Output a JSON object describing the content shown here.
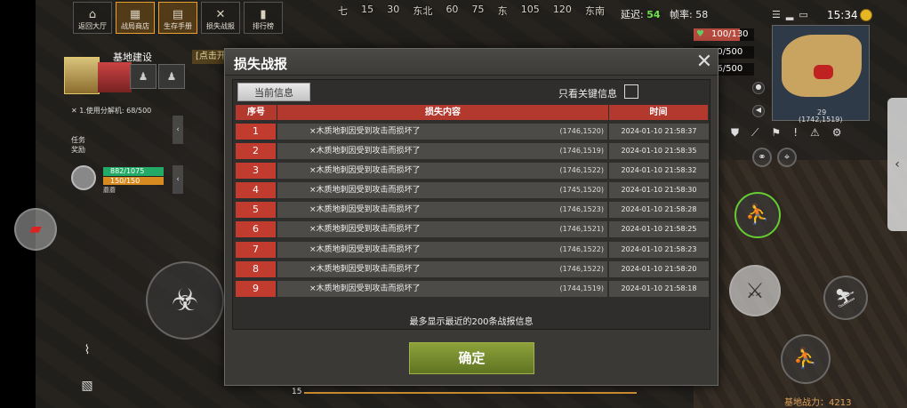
{
  "top_nav": [
    {
      "label": "返回大厅",
      "icon": "home-icon",
      "glyph": "⌂",
      "active": false
    },
    {
      "label": "战局商店",
      "icon": "shop-icon",
      "glyph": "▦",
      "active": true
    },
    {
      "label": "生存手册",
      "icon": "book-icon",
      "glyph": "▤",
      "active": true
    },
    {
      "label": "损失战报",
      "icon": "report-icon",
      "glyph": "✕",
      "active": false
    },
    {
      "label": "排行榜",
      "icon": "leaderboard-icon",
      "glyph": "▮",
      "active": false
    }
  ],
  "compass": [
    "七",
    "15",
    "30",
    "东北",
    "60",
    "75",
    "东",
    "105",
    "120",
    "东南"
  ],
  "network": {
    "ping_label": "延迟:",
    "ping": "54",
    "fps_label": "帧率:",
    "fps": "58"
  },
  "clock": "15:34",
  "stats": {
    "health": "100/130",
    "hunger": "90/500",
    "thirst": "86/500"
  },
  "minimap": {
    "coords": "(1742,1519)",
    "z": "29"
  },
  "left_hud": {
    "base_title": "基地建设",
    "task_line": "1.使用分解机: 68/500",
    "task_label_1": "任务",
    "task_label_2": "奖励",
    "hp": "882/1075",
    "stamina": "150/150",
    "player_name": "蘑蘑"
  },
  "hint_banner": "[点击开",
  "dialog": {
    "title": "损失战报",
    "tab_current": "当前信息",
    "key_filter_label": "只看关键信息",
    "headers": {
      "no": "序号",
      "content": "损失内容",
      "time": "时间"
    },
    "rows": [
      {
        "no": "1",
        "msg": "×木质地刺因受到攻击而损坏了",
        "coord": "(1746,1520)",
        "time": "2024-01-10 21:58:37"
      },
      {
        "no": "2",
        "msg": "×木质地刺因受到攻击而损坏了",
        "coord": "(1746,1519)",
        "time": "2024-01-10 21:58:35"
      },
      {
        "no": "3",
        "msg": "×木质地刺因受到攻击而损坏了",
        "coord": "(1746,1522)",
        "time": "2024-01-10 21:58:32"
      },
      {
        "no": "4",
        "msg": "×木质地刺因受到攻击而损坏了",
        "coord": "(1745,1520)",
        "time": "2024-01-10 21:58:30"
      },
      {
        "no": "5",
        "msg": "×木质地刺因受到攻击而损坏了",
        "coord": "(1746,1523)",
        "time": "2024-01-10 21:58:28"
      },
      {
        "no": "6",
        "msg": "×木质地刺因受到攻击而损坏了",
        "coord": "(1746,1521)",
        "time": "2024-01-10 21:58:25"
      },
      {
        "no": "7",
        "msg": "×木质地刺因受到攻击而损坏了",
        "coord": "(1746,1522)",
        "time": "2024-01-10 21:58:23"
      },
      {
        "no": "8",
        "msg": "×木质地刺因受到攻击而损坏了",
        "coord": "(1746,1522)",
        "time": "2024-01-10 21:58:20"
      },
      {
        "no": "9",
        "msg": "×木质地刺因受到攻击而损坏了",
        "coord": "(1744,1519)",
        "time": "2024-01-10 21:58:18"
      }
    ],
    "footer_note": "最多显示最近的200条战报信息",
    "confirm_label": "确定"
  },
  "bottom": {
    "level": "15",
    "base_power": "基地战力：4213"
  },
  "colors": {
    "accent_red": "#c23b2f",
    "confirm_green": "#7a8f2f",
    "ping_green": "#6de04a"
  }
}
